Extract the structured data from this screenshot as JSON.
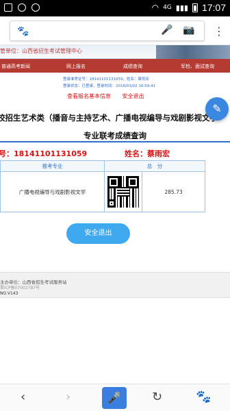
{
  "status_bar": {
    "left_icons": [
      "alert-icon",
      "circle-icon",
      "clock-icon"
    ],
    "network": "4G",
    "time": "17:07"
  },
  "browser": {
    "logo_icon": "baidu-paw-icon",
    "mic_icon": "microphone-icon",
    "camera_icon": "camera-icon",
    "menu_icon": "more-vertical-icon"
  },
  "site": {
    "host_label": "管单位：山西省招生考试管理中心",
    "nav": [
      "普通高考新闻",
      "网上报名",
      "成绩查询",
      "军检、面试查询"
    ],
    "info_line1": "登录准考证号：18141101131059，姓名：蔡雨宏",
    "info_line2": "登录状态：已登录，登录时间：2018/03/02 16:59:41",
    "link_basic": "查看报名基本信息",
    "link_exit": "安全退出",
    "title_line1": "校招生艺术类（播音与主持艺术、广播电视编导与戏剧影视文学",
    "title_line2": "专业联考成绩查询",
    "exam_id": "号：18141101131059",
    "name": "姓名：蔡雨宏",
    "table": {
      "headers": [
        "报考专业",
        "总　分"
      ],
      "rows": [
        {
          "major": "广播电视编导与戏剧影视文学",
          "score": "285.73"
        }
      ]
    },
    "exit_button": "安全退出",
    "footer_host": "主办单位：山西省招生考试服务站",
    "footer_icp": "晋ICP备07002787号",
    "footer_ver": "NO.V143"
  },
  "bottom_bar": {
    "back_icon": "back-arrow-icon",
    "forward_icon": "forward-arrow-icon",
    "voice_icon": "microphone-icon",
    "refresh_icon": "refresh-icon",
    "home_icon": "baidu-paw-icon"
  },
  "colors": {
    "nav_bg": "#b53a32",
    "accent_blue": "#3fa9f0",
    "warning_red": "#d11111"
  }
}
